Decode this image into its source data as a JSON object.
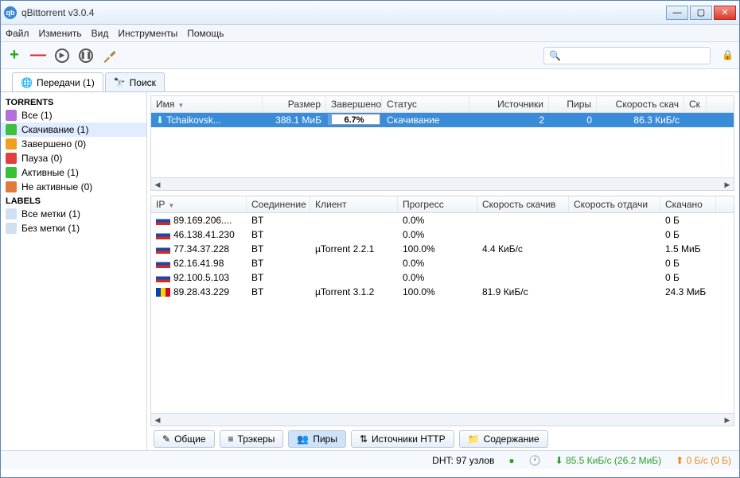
{
  "window": {
    "title": "qBittorrent v3.0.4"
  },
  "menu": {
    "file": "Файл",
    "edit": "Изменить",
    "view": "Вид",
    "tools": "Инструменты",
    "help": "Помощь"
  },
  "search": {
    "placeholder": ""
  },
  "tabs": {
    "transfers": "Передачи (1)",
    "search_tab": "Поиск"
  },
  "sidebar": {
    "hdr_torrents": "Torrents",
    "hdr_labels": "Labels",
    "items": [
      {
        "label": "Все (1)",
        "color": "#b56edb"
      },
      {
        "label": "Скачивание (1)",
        "color": "#3fbf3f"
      },
      {
        "label": "Завершено (0)",
        "color": "#f0a020"
      },
      {
        "label": "Пауза (0)",
        "color": "#e04040"
      },
      {
        "label": "Активные (1)",
        "color": "#35c335"
      },
      {
        "label": "Не активные (0)",
        "color": "#e07a3a"
      }
    ],
    "labels": [
      {
        "label": "Все метки (1)"
      },
      {
        "label": "Без метки (1)"
      }
    ]
  },
  "torrent_table": {
    "headers": {
      "name": "Имя",
      "size": "Размер",
      "done": "Завершено",
      "status": "Статус",
      "sources": "Источники",
      "peers": "Пиры",
      "dspeed": "Скорость скач",
      "sk": "Ск"
    },
    "rows": [
      {
        "name": "Tchaikovsk...",
        "size": "388.1 МиБ",
        "done_pct": 6.7,
        "done_label": "6.7%",
        "status": "Скачивание",
        "sources": "2",
        "peers": "0",
        "dspeed": "86.3 КиБ/с"
      }
    ]
  },
  "peer_table": {
    "headers": {
      "ip": "IP",
      "conn": "Соединение",
      "client": "Клиент",
      "prog": "Прогресс",
      "dspeed": "Скорость скачив",
      "uspeed": "Скорость отдачи",
      "dl": "Скачано"
    },
    "rows": [
      {
        "flag": "ru",
        "ip": "89.169.206....",
        "conn": "BT",
        "client": "",
        "prog": "0.0%",
        "dspeed": "",
        "uspeed": "",
        "dl": "0 Б"
      },
      {
        "flag": "ru",
        "ip": "46.138.41.230",
        "conn": "BT",
        "client": "",
        "prog": "0.0%",
        "dspeed": "",
        "uspeed": "",
        "dl": "0 Б"
      },
      {
        "flag": "ru",
        "ip": "77.34.37.228",
        "conn": "BT",
        "client": "µTorrent 2.2.1",
        "prog": "100.0%",
        "dspeed": "4.4 КиБ/с",
        "uspeed": "",
        "dl": "1.5 МиБ"
      },
      {
        "flag": "ru",
        "ip": "62.16.41.98",
        "conn": "BT",
        "client": "",
        "prog": "0.0%",
        "dspeed": "",
        "uspeed": "",
        "dl": "0 Б"
      },
      {
        "flag": "ru",
        "ip": "92.100.5.103",
        "conn": "BT",
        "client": "",
        "prog": "0.0%",
        "dspeed": "",
        "uspeed": "",
        "dl": "0 Б"
      },
      {
        "flag": "md",
        "ip": "89.28.43.229",
        "conn": "BT",
        "client": "µTorrent 3.1.2",
        "prog": "100.0%",
        "dspeed": "81.9 КиБ/с",
        "uspeed": "",
        "dl": "24.3 МиБ"
      }
    ]
  },
  "bottom_tabs": {
    "general": "Общие",
    "trackers": "Трэкеры",
    "peers": "Пиры",
    "http": "Источники HTTP",
    "content": "Содержание"
  },
  "status": {
    "dht": "DHT: 97 узлов",
    "down": "85.5 КиБ/с (26.2 МиБ)",
    "up": "0 Б/с (0 Б)"
  }
}
